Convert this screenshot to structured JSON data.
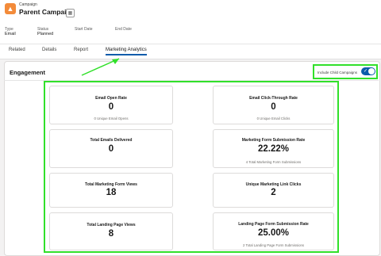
{
  "record": {
    "object_label": "Campaign",
    "title": "Parent Campaign",
    "app_icon": "megaphone-icon",
    "hierarchy_icon": "hierarchy-icon"
  },
  "highlights": [
    {
      "label": "Type",
      "value": "Email"
    },
    {
      "label": "Status",
      "value": "Planned"
    },
    {
      "label": "Start Date",
      "value": ""
    },
    {
      "label": "End Date",
      "value": ""
    }
  ],
  "tabs": [
    {
      "label": "Related"
    },
    {
      "label": "Details"
    },
    {
      "label": "Report"
    },
    {
      "label": "Marketing Analytics",
      "active": true
    }
  ],
  "engagement": {
    "title": "Engagement",
    "toggle": {
      "label": "Include Child Campaigns",
      "checked": true
    }
  },
  "metrics": [
    {
      "title": "Email Open Rate",
      "value": "0",
      "sub": "0  Unique Email Opens"
    },
    {
      "title": "Email Click-Through Rate",
      "value": "0",
      "sub": "0  Unique Email Clicks"
    },
    {
      "title": "Total Emails Delivered",
      "value": "0",
      "sub": ""
    },
    {
      "title": "Marketing Form Submission Rate",
      "value": "22.22%",
      "sub": "4  Total Marketing Form Submissions"
    },
    {
      "title": "Total Marketing Form Views",
      "value": "18",
      "sub": ""
    },
    {
      "title": "Unique Marketing Link Clicks",
      "value": "2",
      "sub": ""
    },
    {
      "title": "Total Landing Page Views",
      "value": "8",
      "sub": ""
    },
    {
      "title": "Landing Page Form Submission Rate",
      "value": "25.00%",
      "sub": "2  Total Landing Page Form Submissions"
    }
  ],
  "colors": {
    "highlight_green": "#31e02a",
    "brand_blue": "#0b5cab",
    "app_icon_orange": "#f38b3a"
  }
}
